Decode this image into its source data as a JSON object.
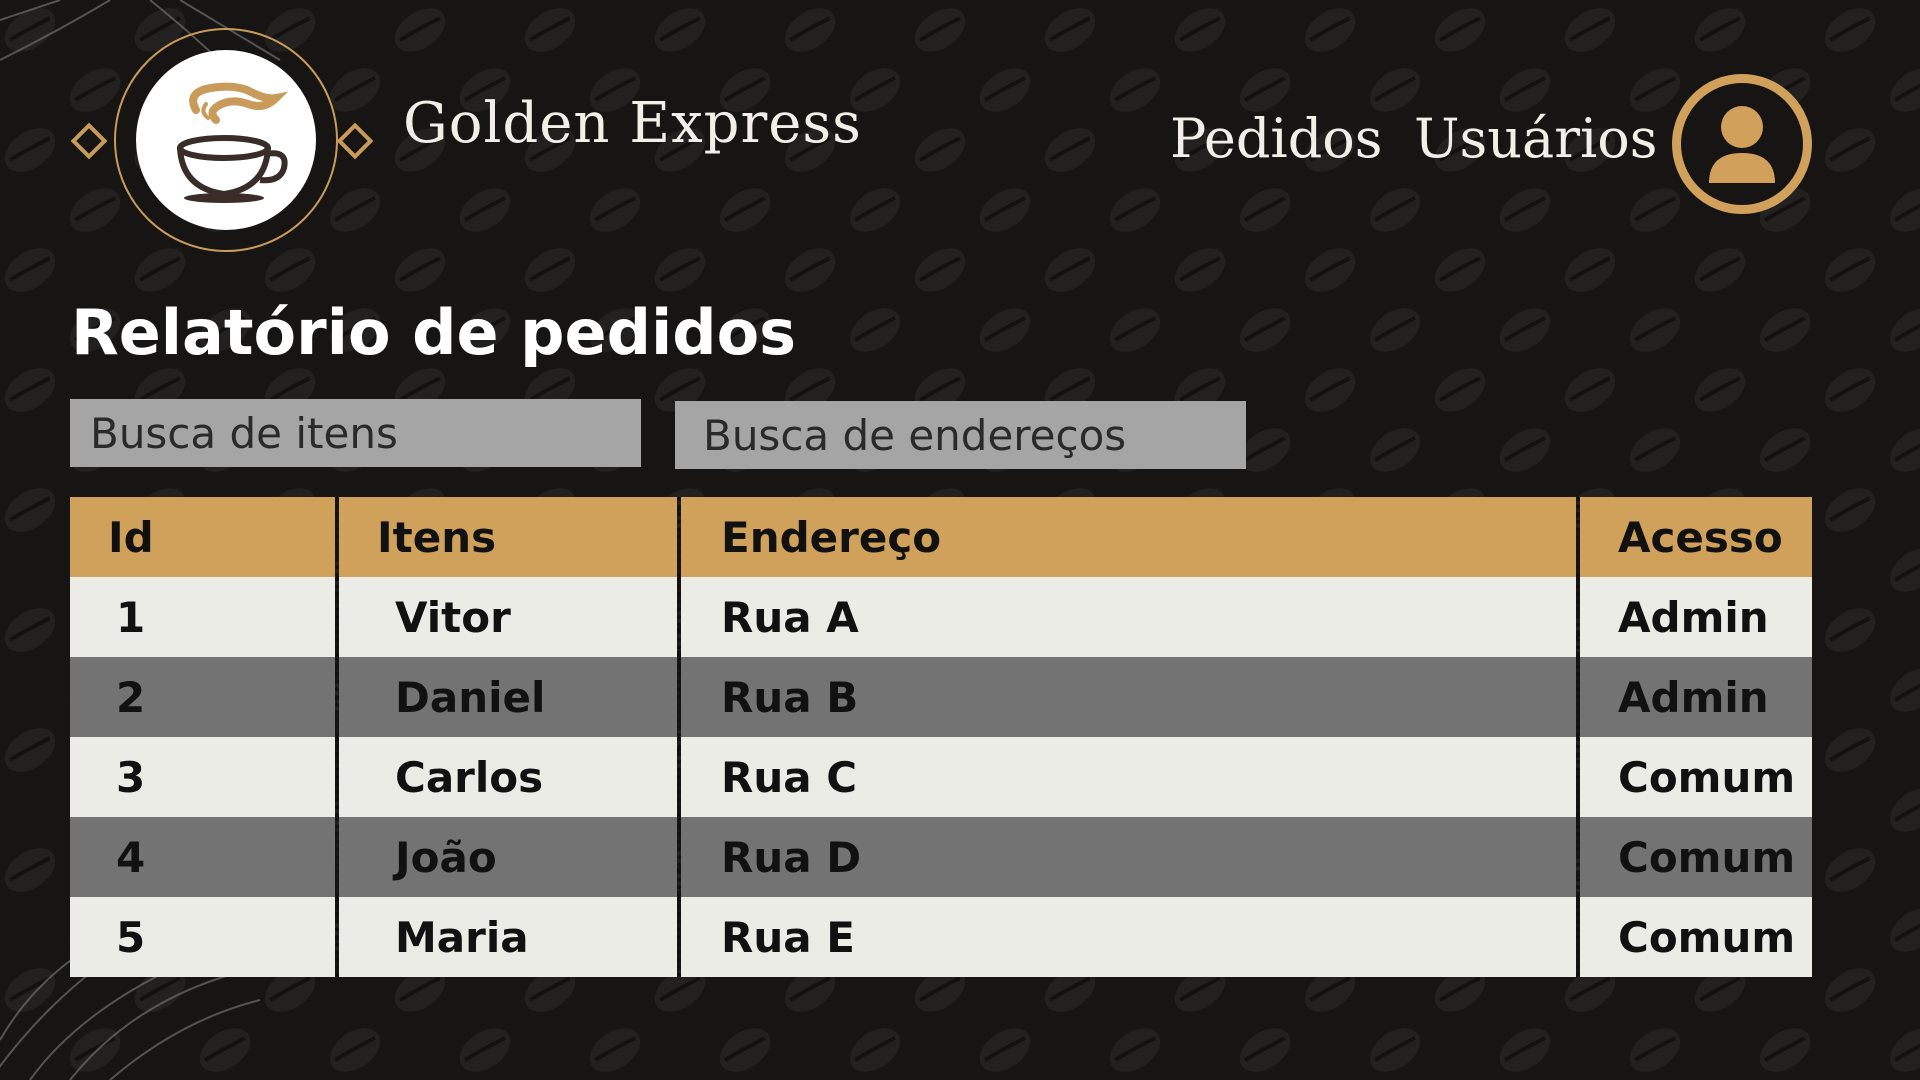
{
  "app": {
    "brand": "Golden Express"
  },
  "nav": {
    "items": [
      {
        "label": "Pedidos"
      },
      {
        "label": "Usuários"
      }
    ],
    "user_icon": "user-avatar-icon"
  },
  "page": {
    "title": "Relatório de pedidos"
  },
  "search": {
    "items_placeholder": "Busca de itens",
    "address_placeholder": "Busca de endereços"
  },
  "table": {
    "headers": [
      "Id",
      "Itens",
      "Endereço",
      "Acesso"
    ],
    "rows": [
      {
        "id": "1",
        "item": "Vitor",
        "address": "Rua A",
        "access": "Admin"
      },
      {
        "id": "2",
        "item": "Daniel",
        "address": "Rua B",
        "access": "Admin"
      },
      {
        "id": "3",
        "item": "Carlos",
        "address": "Rua C",
        "access": "Comum"
      },
      {
        "id": "4",
        "item": "João",
        "address": "Rua D",
        "access": "Comum"
      },
      {
        "id": "5",
        "item": "Maria",
        "address": "Rua E",
        "access": "Comum"
      }
    ]
  },
  "colors": {
    "background": "#161514",
    "accent_gold": "#d0a15a",
    "row_light": "#ecece7",
    "row_dark": "#737373",
    "search_bg": "#a5a5a5"
  },
  "icons": {
    "logo": "coffee-cup-icon",
    "ornament": "diamond-icon"
  }
}
